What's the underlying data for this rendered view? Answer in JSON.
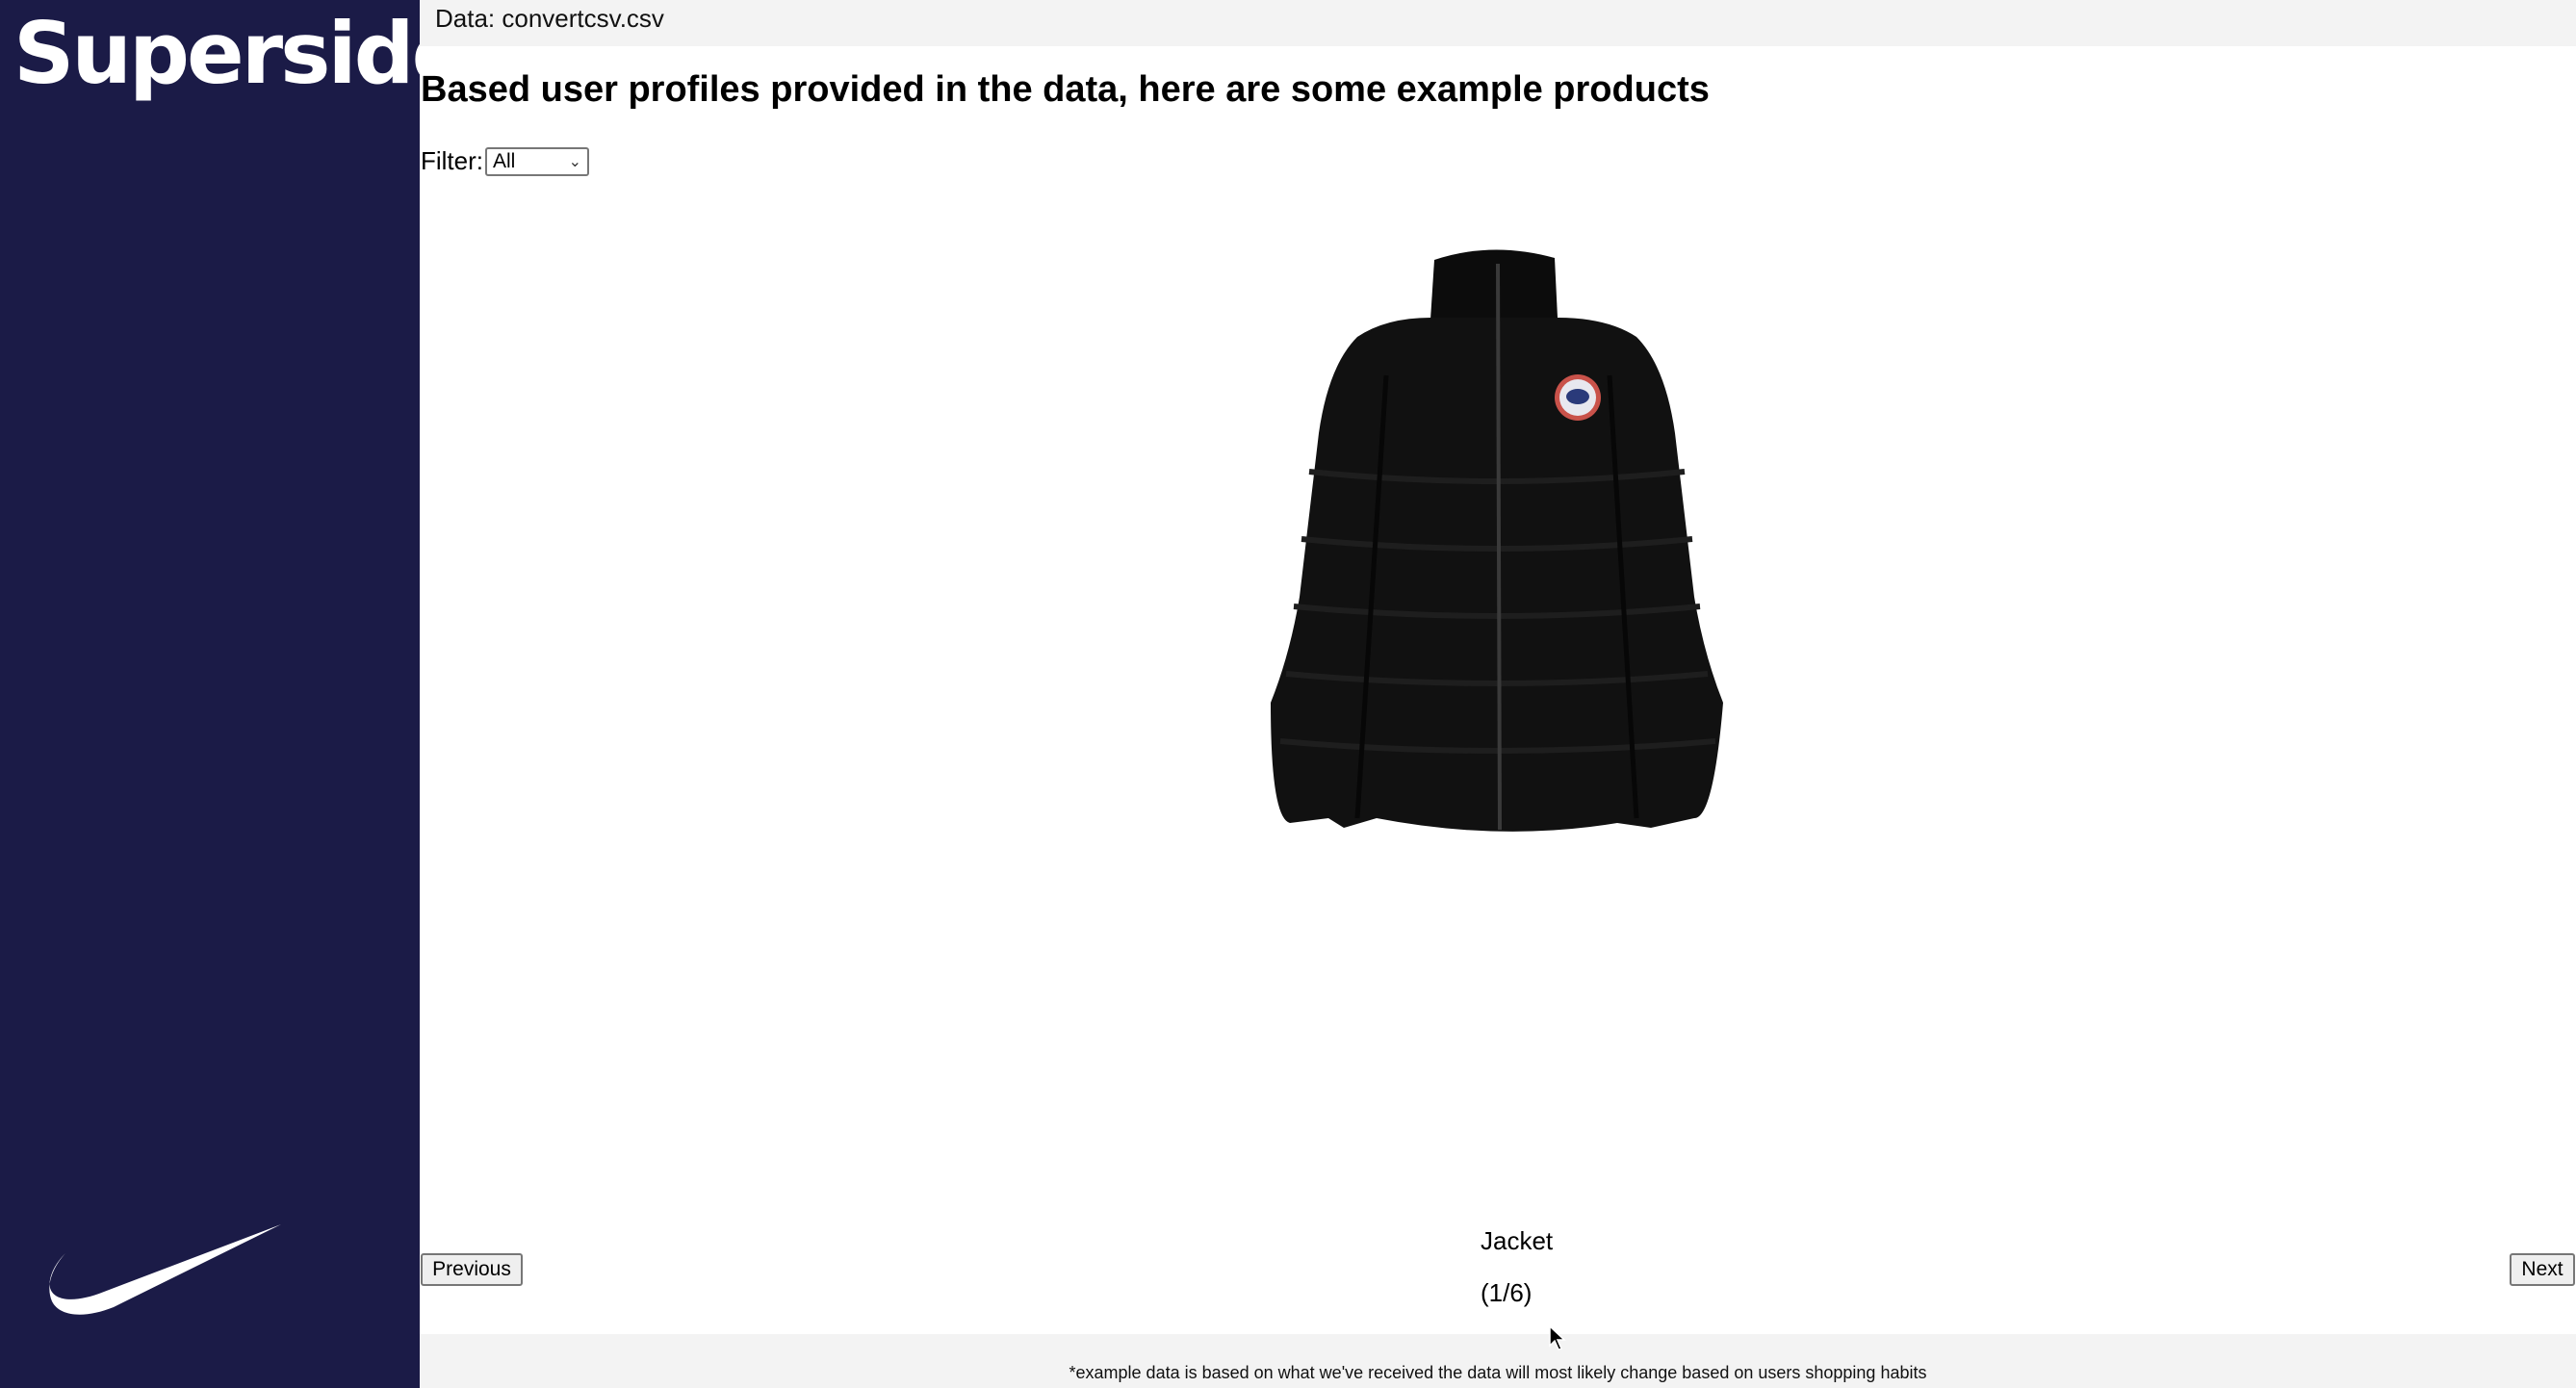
{
  "sidebar": {
    "brand_logo": "Superside",
    "partner_logo_icon": "nike-swoosh-icon"
  },
  "topbar": {
    "data_file_label": "Data: convertcsv.csv"
  },
  "main": {
    "heading": "Based user profiles provided in the data, here are some example products",
    "filter": {
      "label": "Filter:",
      "selected": "All"
    },
    "product": {
      "image_icon": "jacket-image",
      "name": "Jacket",
      "position": "(1/6)"
    },
    "navigation": {
      "previous_label": "Previous",
      "next_label": "Next"
    }
  },
  "footer": {
    "note": "*example data is based on what we've received the data will most likely change based on users shopping habits"
  },
  "colors": {
    "sidebar_bg": "#1b1b47",
    "bar_bg": "#f3f3f3"
  }
}
